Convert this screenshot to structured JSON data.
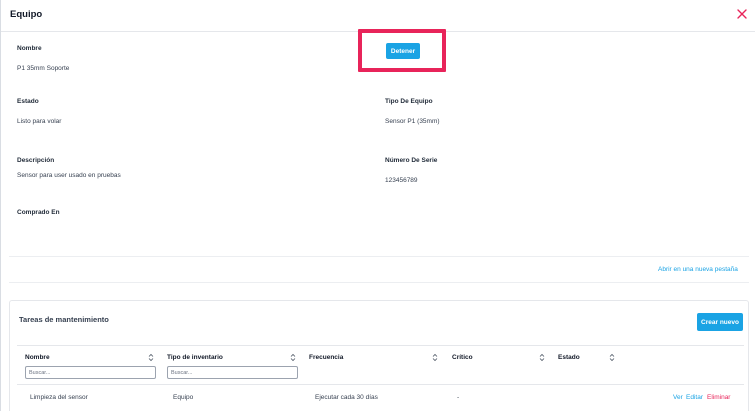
{
  "modal": {
    "title": "Equipo"
  },
  "fields": {
    "nombre_label": "Nombre",
    "nombre_value": "P1 35mm Soporte",
    "estado_label": "Estado",
    "estado_value": "Listo para volar",
    "tipo_label": "Tipo De Equipo",
    "tipo_value": "Sensor P1 (35mm)",
    "descripcion_label": "Descripción",
    "descripcion_value": "Sensor para user usado en pruebas",
    "serie_label": "Número De Serie",
    "serie_value": "123456789",
    "comprado_label": "Comprado En"
  },
  "actions": {
    "detener_label": "Detener",
    "open_tab_label": "Abrir en una nueva pestaña"
  },
  "maintenance": {
    "title": "Tareas de mantenimiento",
    "create_label": "Crear nuevo",
    "columns": [
      "Nombre",
      "Tipo de inventario",
      "Frecuencia",
      "Crítico",
      "Estado"
    ],
    "filter_placeholder": "Buscar...",
    "rows": [
      {
        "nombre": "Limpieza del sensor",
        "tipo": "Equipo",
        "frecuencia": "Ejecutar cada 30 días",
        "critico": "-",
        "estado": "",
        "ver": "Ver",
        "editar": "Editar",
        "eliminar": "Eliminar"
      }
    ]
  },
  "colors": {
    "accent": "#1aa3e4",
    "danger": "#e8245a",
    "highlight": "#e8245a"
  }
}
